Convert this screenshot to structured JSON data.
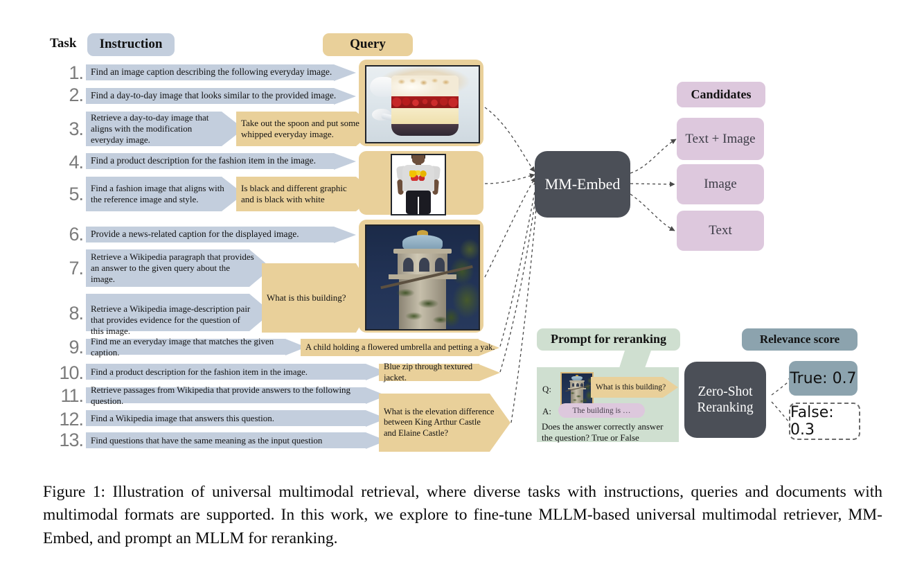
{
  "headers": {
    "task": "Task",
    "instruction": "Instruction",
    "query": "Query",
    "candidates": "Candidates",
    "prompt_for_reranking": "Prompt for reranking",
    "relevance_score": "Relevance score"
  },
  "tasks": [
    {
      "num": "1.",
      "instruction": "Find an image caption describing the following everyday image."
    },
    {
      "num": "2.",
      "instruction": "Find a day-to-day image that looks similar to the provided image."
    },
    {
      "num": "3.",
      "instruction": "Retrieve a day-to-day image that aligns with the modification everyday image."
    },
    {
      "num": "4.",
      "instruction": "Find a product description for the fashion item in the image."
    },
    {
      "num": "5.",
      "instruction": "Find a fashion image that aligns with the reference image and style."
    },
    {
      "num": "6.",
      "instruction": "Provide a news-related caption for the displayed image."
    },
    {
      "num": "7.",
      "instruction": "Retrieve a Wikipedia paragraph that provides an answer to the given query about the image."
    },
    {
      "num": "8.",
      "instruction": "Retrieve a Wikipedia image-description pair that provides evidence for the question of this image."
    },
    {
      "num": "9.",
      "instruction": "Find me an everyday image that matches the given caption."
    },
    {
      "num": "10.",
      "instruction": "Find a product description for the fashion item in the image."
    },
    {
      "num": "11.",
      "instruction": "Retrieve passages from Wikipedia that provide answers to the following question."
    },
    {
      "num": "12.",
      "instruction": "Find a Wikipedia image that answers this question."
    },
    {
      "num": "13.",
      "instruction": "Find questions that have the same meaning as the input question"
    }
  ],
  "queries": {
    "modification_text": "Take out the spoon and put some whipped everyday image.",
    "fashion_style_text": "Is black and different graphic and is black with white",
    "building_question": "What is this building?",
    "caption_yak": "A child holding a flowered umbrella and petting a yak.",
    "product_jacket": "Blue zip through textured jacket.",
    "elevation_question": "What is the elevation difference between King Arthur Castle and Elaine Castle?"
  },
  "query_images": [
    {
      "name": "trifle-dessert-image",
      "alt": "Layered trifle dessert in a glass bowl"
    },
    {
      "name": "tshirt-model-image",
      "alt": "Person wearing a graphic t-shirt"
    },
    {
      "name": "clock-tower-image",
      "alt": "Stone tower with blue dome against dark sky"
    }
  ],
  "model": {
    "embed_label": "MM-Embed",
    "rerank_label_line1": "Zero-Shot",
    "rerank_label_line2": "Reranking"
  },
  "candidates": [
    {
      "label": "Text + Image"
    },
    {
      "label": "Image"
    },
    {
      "label": "Text"
    }
  ],
  "prompt": {
    "q_label": "Q:",
    "a_label": "A:",
    "question": "What is this building?",
    "answer": "The building is …",
    "footer_line1": "Does the answer correctly answer the",
    "footer_line2": "question? True or False"
  },
  "scores": [
    {
      "label": "True: 0.7",
      "name": "true-score"
    },
    {
      "label": "False: 0.3",
      "name": "false-score"
    }
  ],
  "caption": "Figure 1: Illustration of universal multimodal retrieval, where diverse tasks with instructions, queries and documents with multimodal formats are supported. In this work, we explore to fine-tune MLLM-based universal multimodal retriever, MM-Embed, and prompt an MLLM for reranking.",
  "colors": {
    "instruction": "#c3cedd",
    "query": "#e9d09a",
    "candidate": "#ddc8dd",
    "prompt": "#cfdfd0",
    "relevance": "#8ca3ae",
    "model": "#4b4f57"
  }
}
